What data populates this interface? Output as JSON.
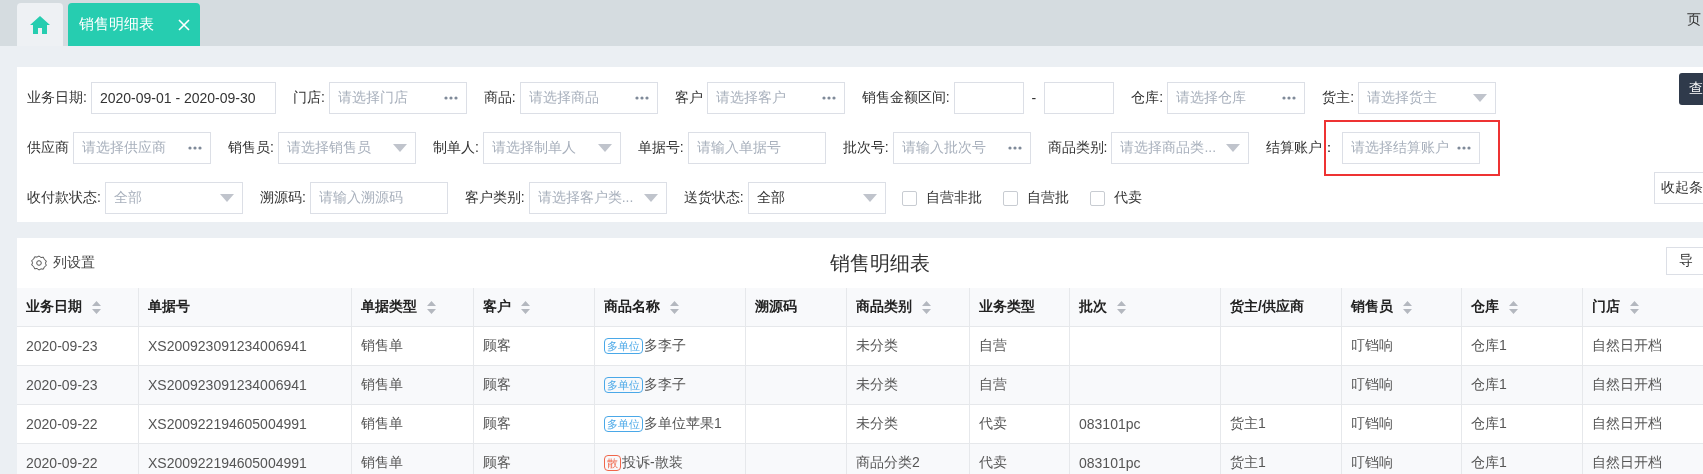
{
  "tabs": [
    {
      "kind": "home",
      "selected": false
    },
    {
      "kind": "page",
      "label": "销售明细表",
      "selected": true
    }
  ],
  "top_right_text": "页",
  "filters": [
    [
      {
        "label": "业务日期:",
        "kind": "date",
        "value": "2020-09-01 - 2020-09-30"
      },
      {
        "label": "门店:",
        "kind": "picker",
        "placeholder": "请选择门店"
      },
      {
        "label": "商品:",
        "kind": "picker",
        "placeholder": "请选择商品"
      },
      {
        "label": "客户",
        "kind": "picker",
        "placeholder": "请选择客户"
      },
      {
        "label": "销售金额区间:",
        "kind": "range",
        "separator": "-"
      },
      {
        "label": "仓库:",
        "kind": "picker",
        "placeholder": "请选择仓库"
      },
      {
        "label": "货主:",
        "kind": "dropdown",
        "placeholder": "请选择货主"
      }
    ],
    [
      {
        "label": "供应商",
        "kind": "picker",
        "placeholder": "请选择供应商"
      },
      {
        "label": "销售员:",
        "kind": "dropdown",
        "placeholder": "请选择销售员"
      },
      {
        "label": "制单人:",
        "kind": "dropdown",
        "placeholder": "请选择制单人"
      },
      {
        "label": "单据号:",
        "kind": "text",
        "placeholder": "请输入单据号"
      },
      {
        "label": "批次号:",
        "kind": "picker",
        "placeholder": "请输入批次号"
      },
      {
        "label": "商品类别:",
        "kind": "dropdown",
        "placeholder": "请选择商品类..."
      },
      {
        "label": "结算账户：",
        "kind": "picker",
        "placeholder": "请选择结算账户",
        "highlighted": true
      }
    ],
    [
      {
        "label": "收付款状态:",
        "kind": "dropdown",
        "placeholder": "全部"
      },
      {
        "label": "溯源码:",
        "kind": "text",
        "placeholder": "请输入溯源码"
      },
      {
        "label": "客户类别:",
        "kind": "dropdown",
        "placeholder": "请选择客户类..."
      },
      {
        "label": "送货状态:",
        "kind": "dropdown",
        "value": "全部"
      },
      {
        "label": "自营非批",
        "kind": "checkbox",
        "checked": false
      },
      {
        "label": "自营批",
        "kind": "checkbox",
        "checked": false
      },
      {
        "label": "代卖",
        "kind": "checkbox",
        "checked": false
      }
    ]
  ],
  "search_button": "查",
  "collapse_button": "收起条",
  "table_toolbar": {
    "settings": "列设置",
    "title": "销售明细表",
    "export": "导"
  },
  "table": {
    "columns": [
      {
        "label": "业务日期",
        "sortable": true
      },
      {
        "label": "单据号",
        "sortable": false
      },
      {
        "label": "单据类型",
        "sortable": true
      },
      {
        "label": "客户",
        "sortable": true
      },
      {
        "label": "商品名称",
        "sortable": true
      },
      {
        "label": "溯源码",
        "sortable": false
      },
      {
        "label": "商品类别",
        "sortable": true
      },
      {
        "label": "业务类型",
        "sortable": false
      },
      {
        "label": "批次",
        "sortable": true
      },
      {
        "label": "货主/供应商",
        "sortable": false
      },
      {
        "label": "销售员",
        "sortable": true
      },
      {
        "label": "仓库",
        "sortable": true
      },
      {
        "label": "门店",
        "sortable": true
      }
    ],
    "rows": [
      {
        "cells": [
          "2020-09-23",
          "XS200923091234006941",
          "销售单",
          "顾客",
          {
            "tag": "多单位",
            "color": "#4aa8e8",
            "text": "多李子"
          },
          "",
          "未分类",
          "自营",
          "",
          "",
          "叮铛响",
          "仓库1",
          "自然日开档"
        ]
      },
      {
        "cells": [
          "2020-09-23",
          "XS200923091234006941",
          "销售单",
          "顾客",
          {
            "tag": "多单位",
            "color": "#4aa8e8",
            "text": "多李子"
          },
          "",
          "未分类",
          "自营",
          "",
          "",
          "叮铛响",
          "仓库1",
          "自然日开档"
        ]
      },
      {
        "cells": [
          "2020-09-22",
          "XS200922194605004991",
          "销售单",
          "顾客",
          {
            "tag": "多单位",
            "color": "#4aa8e8",
            "text": "多单位苹果1"
          },
          "",
          "未分类",
          "代卖",
          "083101pc",
          "货主1",
          "叮铛响",
          "仓库1",
          "自然日开档"
        ]
      },
      {
        "cells": [
          "2020-09-22",
          "XS200922194605004991",
          "销售单",
          "顾客",
          {
            "tag": "散",
            "color": "#f0664a",
            "text": "投诉-散装"
          },
          "",
          "商品分类2",
          "代卖",
          "083101pc",
          "货主1",
          "叮铛响",
          "仓库1",
          "自然日开档"
        ]
      }
    ]
  }
}
